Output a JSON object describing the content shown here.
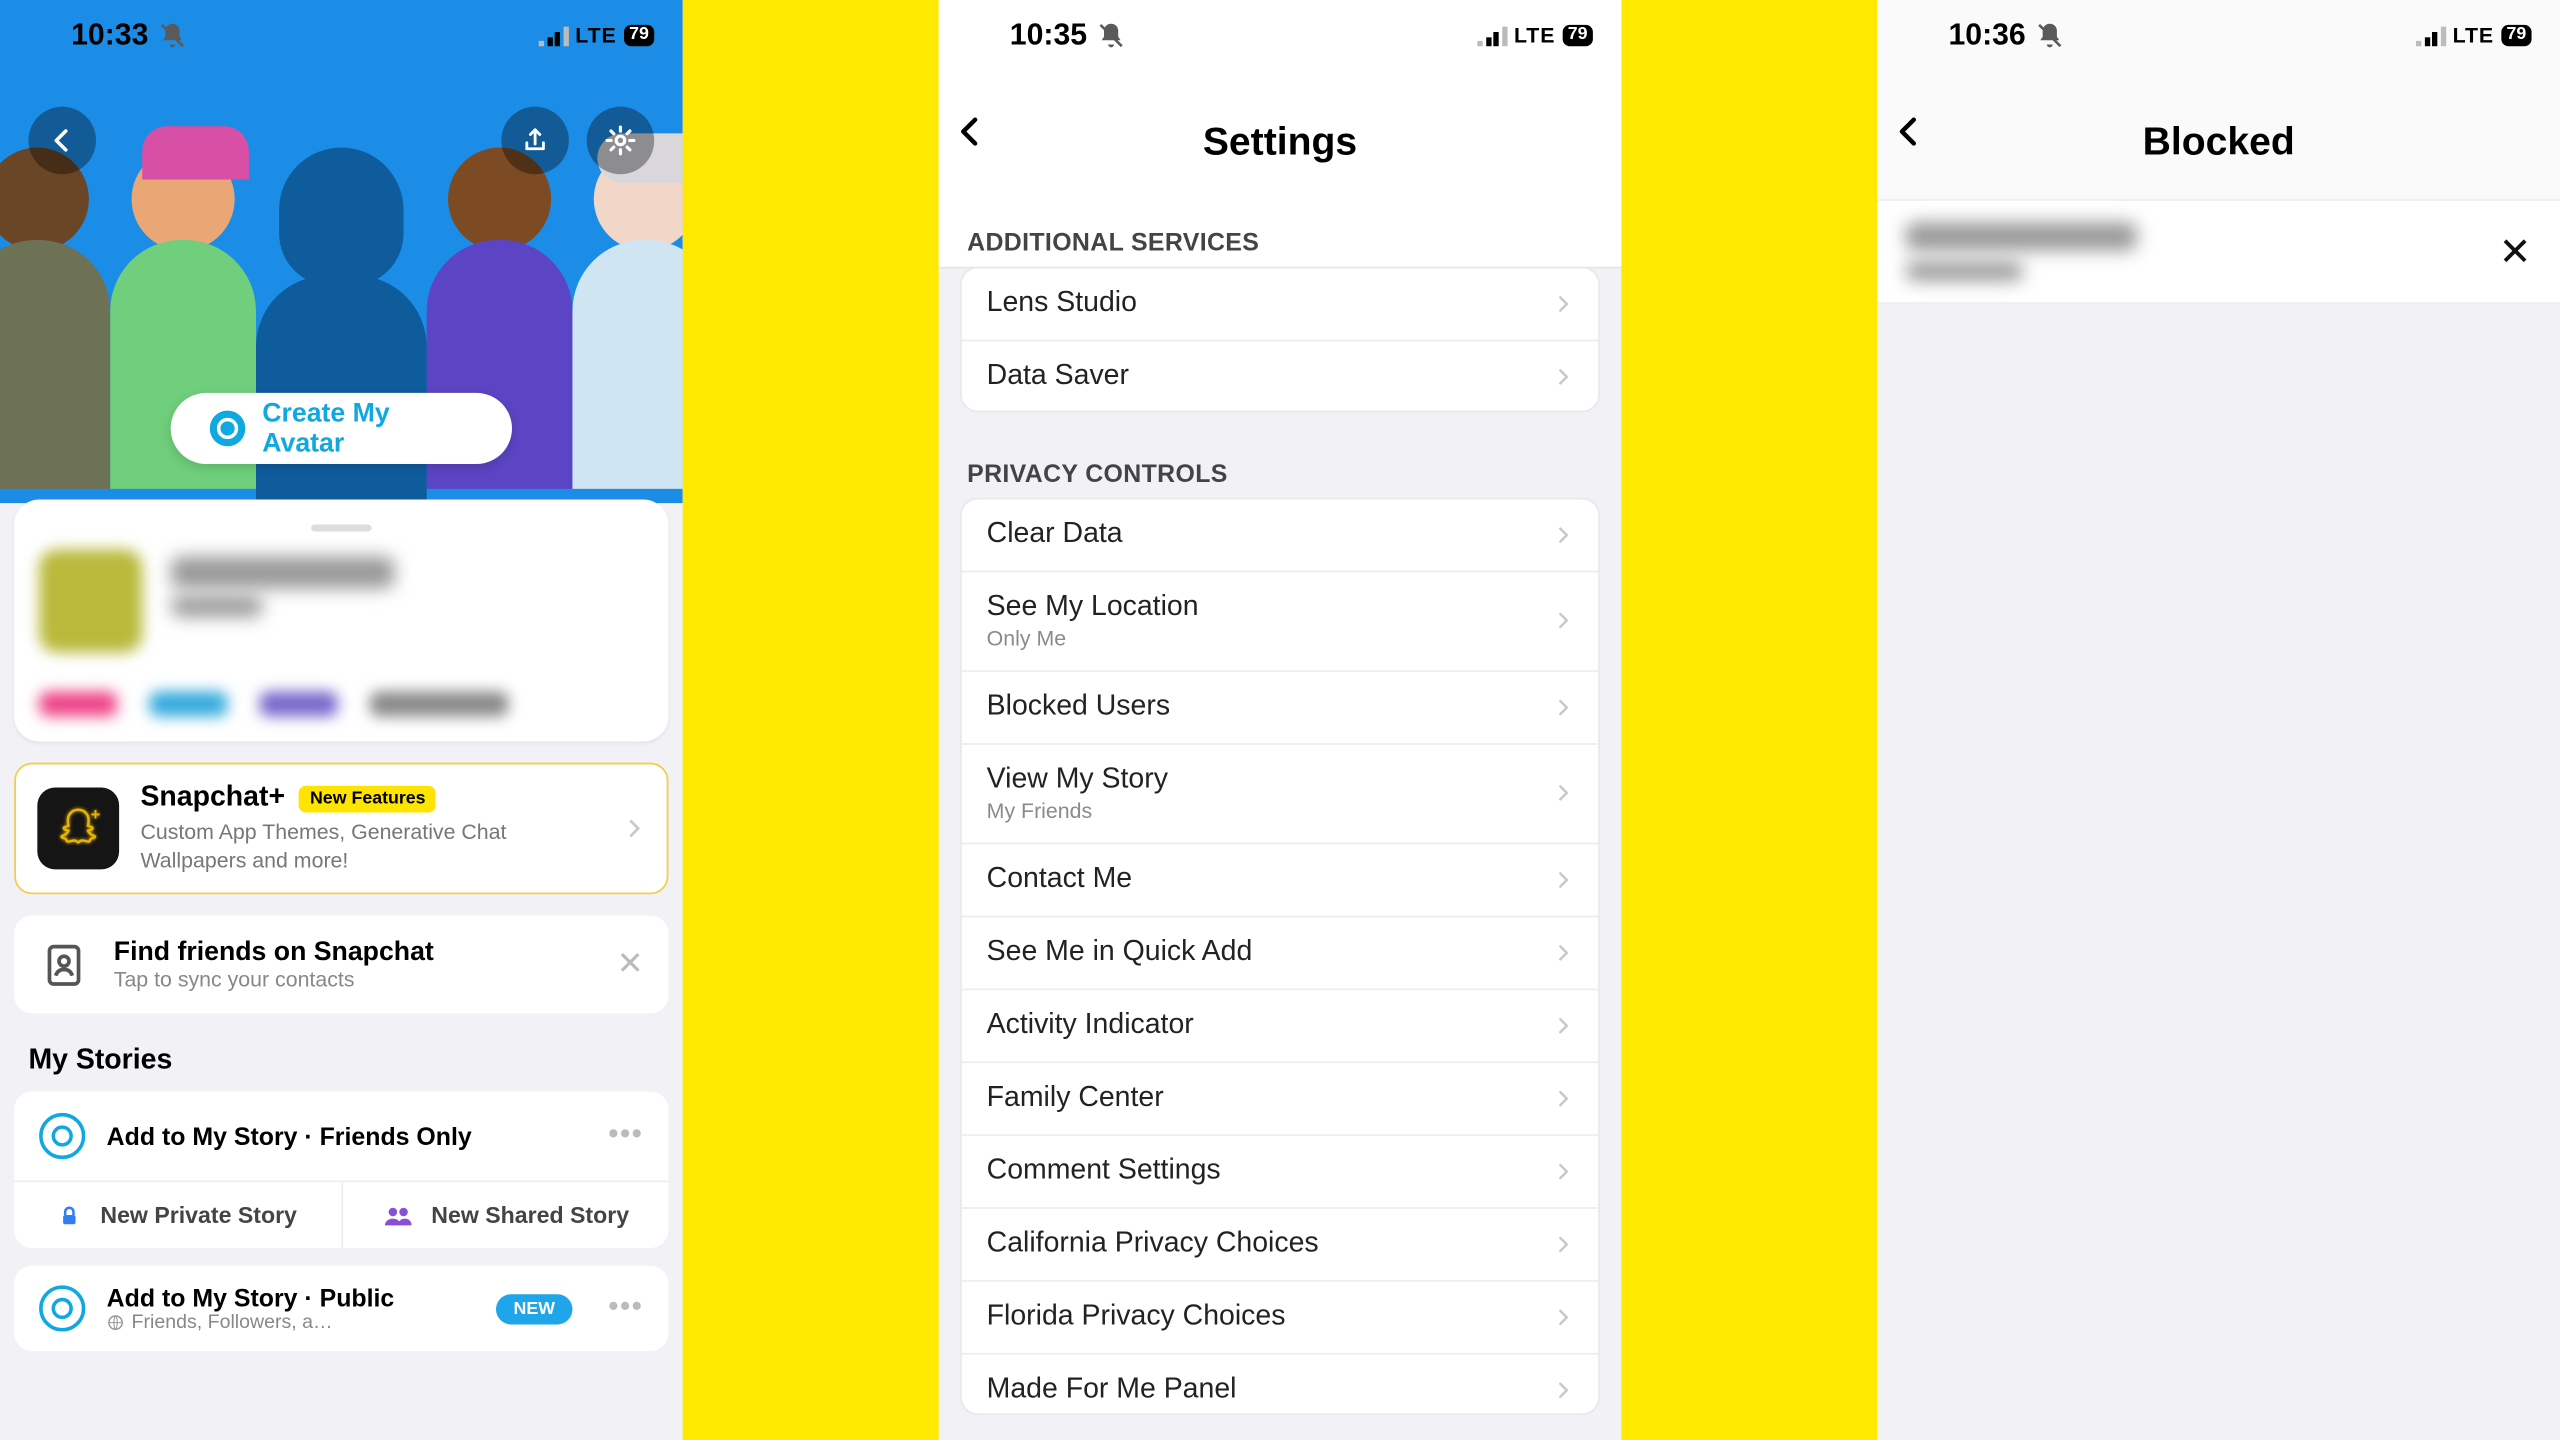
{
  "status": {
    "times": [
      "10:33",
      "10:35",
      "10:36"
    ],
    "carrier": "LTE",
    "battery": "79"
  },
  "screen1": {
    "createAvatar": "Create My Avatar",
    "plus": {
      "title": "Snapchat+",
      "badge": "New Features",
      "sub": "Custom App Themes, Generative Chat Wallpapers and more!"
    },
    "find": {
      "title": "Find friends on Snapchat",
      "sub": "Tap to sync your contacts"
    },
    "myStories": "My Stories",
    "story1": "Add to My Story · Friends Only",
    "newPrivate": "New Private Story",
    "newShared": "New Shared Story",
    "story2": "Add to My Story · Public",
    "story2sub": "Friends, Followers, a…",
    "newPill": "NEW"
  },
  "screen2": {
    "title": "Settings",
    "sectA": "ADDITIONAL SERVICES",
    "listA": [
      {
        "label": "Lens Studio"
      },
      {
        "label": "Data Saver"
      }
    ],
    "sectB": "PRIVACY CONTROLS",
    "listB": [
      {
        "label": "Clear Data"
      },
      {
        "label": "See My Location",
        "sub": "Only Me"
      },
      {
        "label": "Blocked Users"
      },
      {
        "label": "View My Story",
        "sub": "My Friends"
      },
      {
        "label": "Contact Me"
      },
      {
        "label": "See Me in Quick Add"
      },
      {
        "label": "Activity Indicator"
      },
      {
        "label": "Family Center"
      },
      {
        "label": "Comment Settings"
      },
      {
        "label": "California Privacy Choices"
      },
      {
        "label": "Florida Privacy Choices"
      },
      {
        "label": "Made For Me Panel"
      }
    ]
  },
  "screen3": {
    "title": "Blocked"
  }
}
